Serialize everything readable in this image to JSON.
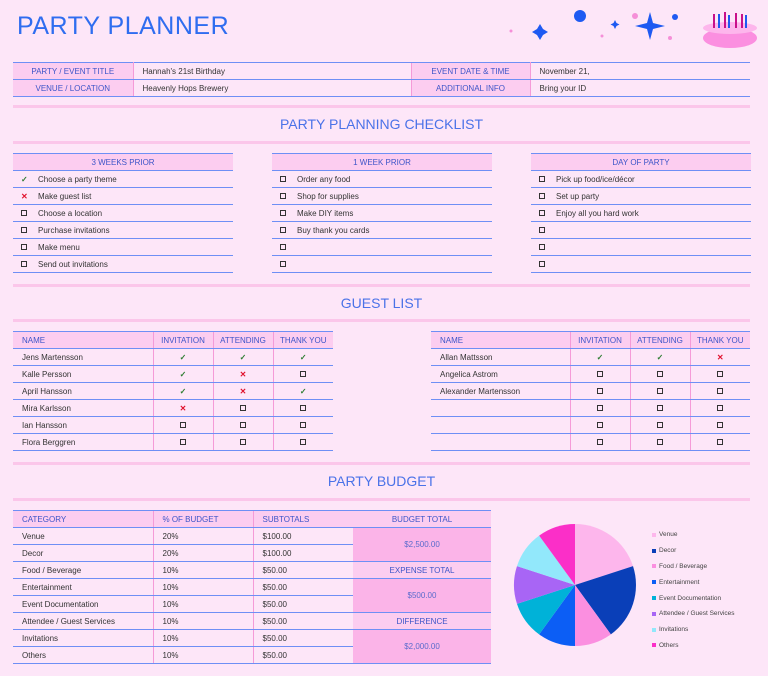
{
  "title": "PARTY PLANNER",
  "info": {
    "event_title_label": "PARTY / EVENT TITLE",
    "event_title": "Hannah's 21st Birthday",
    "date_label": "EVENT DATE & TIME",
    "date": "November 21,",
    "venue_label": "VENUE / LOCATION",
    "venue": "Heavenly Hops Brewery",
    "additional_label": "ADDITIONAL INFO",
    "additional": "Bring your ID"
  },
  "checklist": {
    "title": "PARTY PLANNING CHECKLIST",
    "columns": [
      {
        "header": "3 WEEKS PRIOR",
        "items": [
          {
            "s": "check",
            "t": "Choose a party theme"
          },
          {
            "s": "x",
            "t": "Make guest list"
          },
          {
            "s": "box",
            "t": "Choose a location"
          },
          {
            "s": "box",
            "t": "Purchase invitations"
          },
          {
            "s": "box",
            "t": "Make menu"
          },
          {
            "s": "box",
            "t": "Send out invitations"
          }
        ]
      },
      {
        "header": "1 WEEK PRIOR",
        "items": [
          {
            "s": "box",
            "t": "Order any food"
          },
          {
            "s": "box",
            "t": "Shop for supplies"
          },
          {
            "s": "box",
            "t": "Make DIY items"
          },
          {
            "s": "box",
            "t": "Buy thank you cards"
          },
          {
            "s": "box",
            "t": ""
          },
          {
            "s": "box",
            "t": ""
          }
        ]
      },
      {
        "header": "DAY OF PARTY",
        "items": [
          {
            "s": "box",
            "t": "Pick up food/ice/décor"
          },
          {
            "s": "box",
            "t": "Set up party"
          },
          {
            "s": "box",
            "t": "Enjoy all you hard work"
          },
          {
            "s": "box",
            "t": ""
          },
          {
            "s": "box",
            "t": ""
          },
          {
            "s": "box",
            "t": ""
          }
        ]
      }
    ]
  },
  "guests": {
    "title": "GUEST LIST",
    "headers": [
      "NAME",
      "INVITATION",
      "ATTENDING",
      "THANK YOU"
    ],
    "left": [
      [
        "Jens Martensson",
        "check",
        "check",
        "check"
      ],
      [
        "Kalle Persson",
        "check",
        "x",
        "box"
      ],
      [
        "April Hansson",
        "check",
        "x",
        "check"
      ],
      [
        "Mira Karlsson",
        "x",
        "box",
        "box"
      ],
      [
        "Ian Hansson",
        "box",
        "box",
        "box"
      ],
      [
        "Flora Berggren",
        "box",
        "box",
        "box"
      ]
    ],
    "right": [
      [
        "Allan Mattsson",
        "check",
        "check",
        "x"
      ],
      [
        "Angelica Astrom",
        "box",
        "box",
        "box"
      ],
      [
        "Alexander Martensson",
        "box",
        "box",
        "box"
      ],
      [
        "",
        "box",
        "box",
        "box"
      ],
      [
        "",
        "box",
        "box",
        "box"
      ],
      [
        "",
        "box",
        "box",
        "box"
      ]
    ]
  },
  "budget": {
    "title": "PARTY BUDGET",
    "headers": [
      "CATEGORY",
      "% OF BUDGET",
      "SUBTOTALS"
    ],
    "rows": [
      [
        "Venue",
        "20%",
        "$100.00"
      ],
      [
        "Decor",
        "20%",
        "$100.00"
      ],
      [
        "Food / Beverage",
        "10%",
        "$50.00"
      ],
      [
        "Entertainment",
        "10%",
        "$50.00"
      ],
      [
        "Event Documentation",
        "10%",
        "$50.00"
      ],
      [
        "Attendee / Guest Services",
        "10%",
        "$50.00"
      ],
      [
        "Invitations",
        "10%",
        "$50.00"
      ],
      [
        "Others",
        "10%",
        "$50.00"
      ]
    ],
    "budget_total_label": "BUDGET TOTAL",
    "budget_total": "$2,500.00",
    "expense_total_label": "EXPENSE TOTAL",
    "expense_total": "$500.00",
    "difference_label": "DIFFERENCE",
    "difference": "$2,000.00"
  },
  "chart_data": {
    "type": "pie",
    "categories": [
      "Venue",
      "Decor",
      "Food / Beverage",
      "Entertainment",
      "Event Documentation",
      "Attendee / Guest Services",
      "Invitations",
      "Others"
    ],
    "values": [
      100,
      100,
      50,
      50,
      50,
      50,
      50,
      50
    ],
    "colors": [
      "#fdb6ec",
      "#0a3fb8",
      "#fb8fe0",
      "#0c5ef5",
      "#00b2d8",
      "#a865f5",
      "#92e8fb",
      "#fb2fc8"
    ],
    "legend": "right"
  }
}
